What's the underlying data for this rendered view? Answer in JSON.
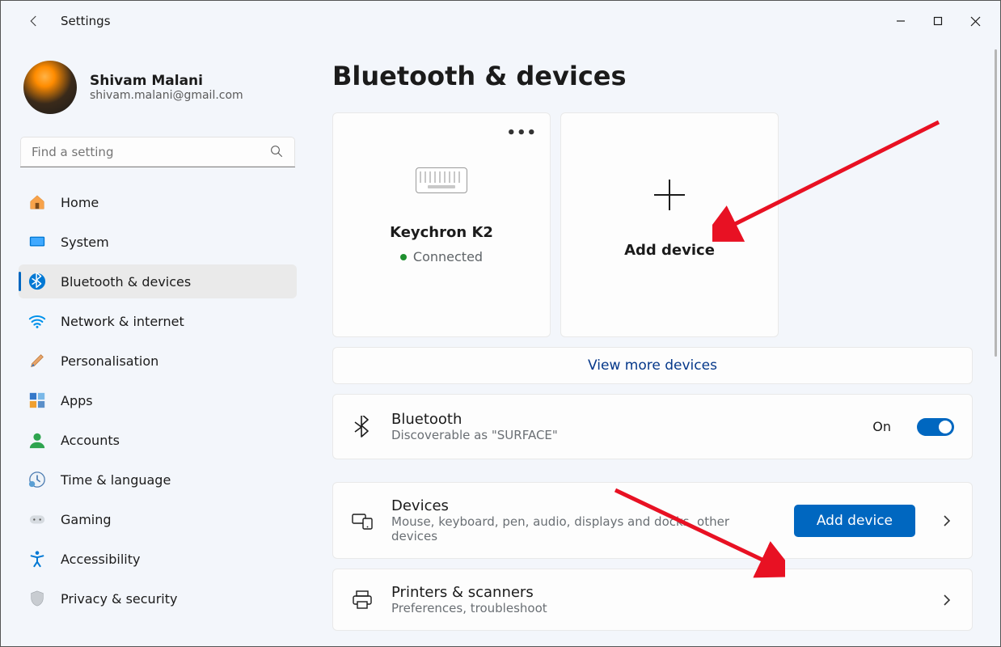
{
  "app_title": "Settings",
  "profile": {
    "name": "Shivam Malani",
    "email": "shivam.malani@gmail.com"
  },
  "search": {
    "placeholder": "Find a setting"
  },
  "nav": {
    "home": "Home",
    "system": "System",
    "bluetooth": "Bluetooth & devices",
    "network": "Network & internet",
    "personalisation": "Personalisation",
    "apps": "Apps",
    "accounts": "Accounts",
    "time": "Time & language",
    "gaming": "Gaming",
    "accessibility": "Accessibility",
    "privacy": "Privacy & security"
  },
  "page": {
    "title": "Bluetooth & devices",
    "device_card": {
      "name": "Keychron K2",
      "status": "Connected"
    },
    "add_card": "Add device",
    "view_more": "View more devices",
    "bluetooth_row": {
      "title": "Bluetooth",
      "sub": "Discoverable as \"SURFACE\"",
      "state": "On"
    },
    "devices_row": {
      "title": "Devices",
      "sub": "Mouse, keyboard, pen, audio, displays and docks, other devices",
      "button": "Add device"
    },
    "printers_row": {
      "title": "Printers & scanners",
      "sub": "Preferences, troubleshoot"
    }
  }
}
